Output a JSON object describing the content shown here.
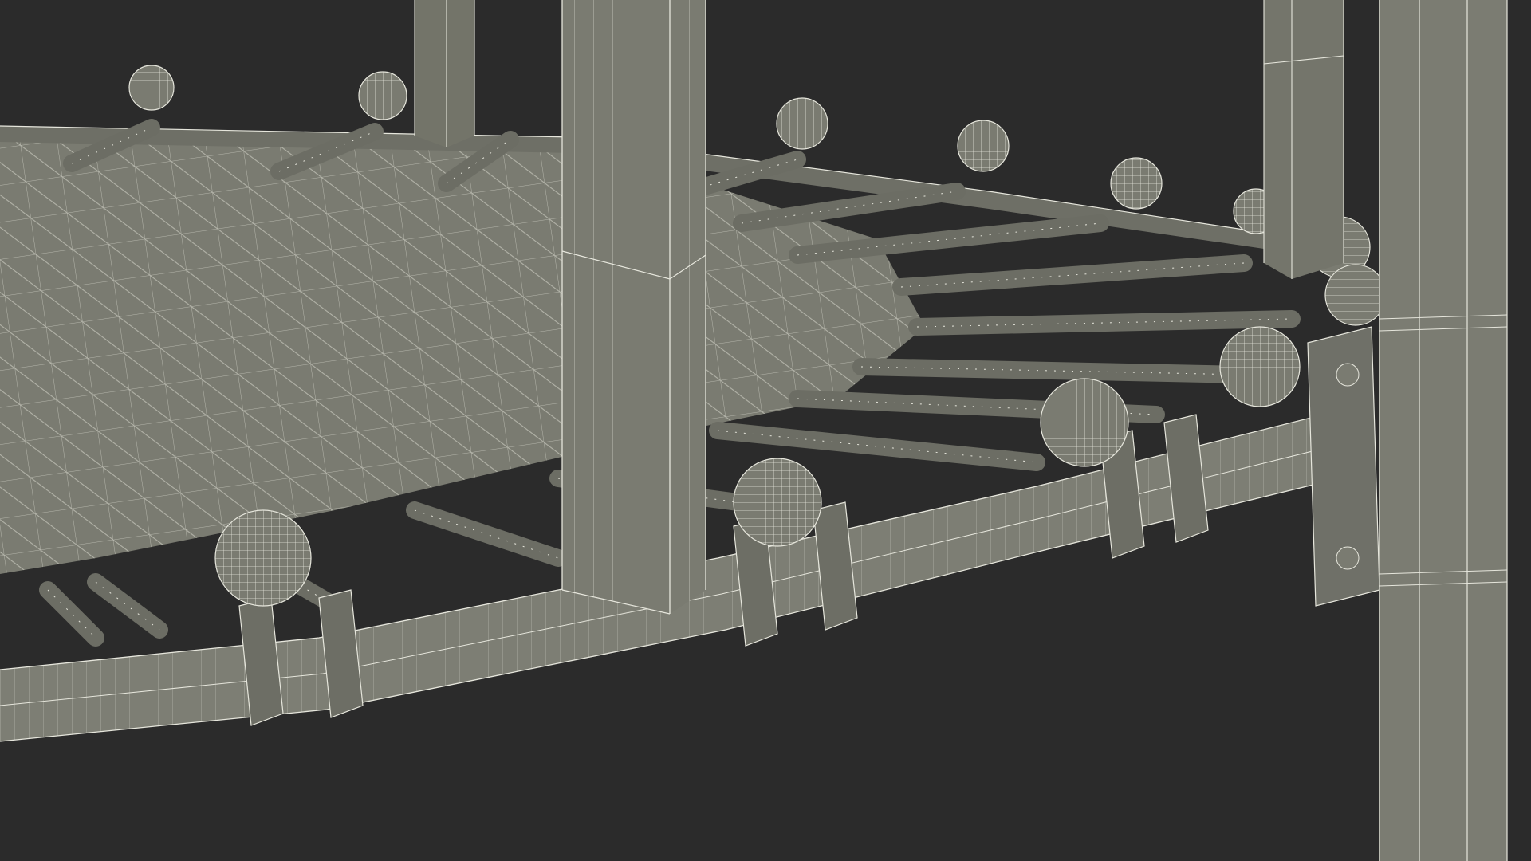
{
  "scene": {
    "kind": "3d-wireframe-render",
    "subject": "trampoline-frame-with-springs",
    "background_color": "#2b2b2b",
    "surface_color": "#7a7b71",
    "surface_dark_color": "#5f6058",
    "wire_color": "#e6e6dc"
  }
}
